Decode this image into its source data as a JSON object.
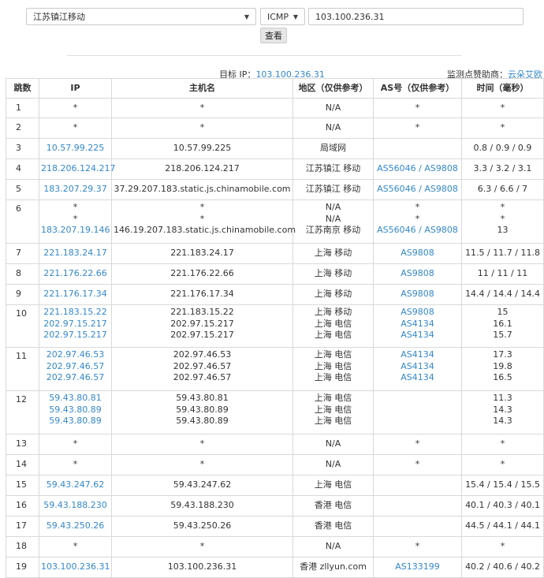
{
  "controls": {
    "location_value": "江苏镇江移动",
    "protocol_value": "ICMP",
    "target_input_value": "103.100.236.31",
    "submit_label": "查看"
  },
  "info": {
    "target_label": "目标 IP：",
    "target_ip": "103.100.236.31",
    "sponsor_label": "监测点赞助商：",
    "sponsor_name": "云朵艾欧"
  },
  "table": {
    "headers": [
      "跳数",
      "IP",
      "主机名",
      "地区（仅供参考）",
      "AS号（仅供参考）",
      "时间（毫秒）"
    ],
    "rows": [
      {
        "hop": "1",
        "ip": [
          "*"
        ],
        "host": [
          "*"
        ],
        "region": [
          "N/A"
        ],
        "as": [
          "*"
        ],
        "time": [
          "*"
        ]
      },
      {
        "hop": "2",
        "ip": [
          "*"
        ],
        "host": [
          "*"
        ],
        "region": [
          "N/A"
        ],
        "as": [
          "*"
        ],
        "time": [
          "*"
        ]
      },
      {
        "hop": "3",
        "ip": [
          "10.57.99.225"
        ],
        "host": [
          "10.57.99.225"
        ],
        "region": [
          "局域网"
        ],
        "as": [
          ""
        ],
        "time": [
          "0.8 / 0.9 / 0.9"
        ]
      },
      {
        "hop": "4",
        "ip": [
          "218.206.124.217"
        ],
        "host": [
          "218.206.124.217"
        ],
        "region": [
          "江苏镇江 移动"
        ],
        "as": [
          "AS56046 / AS9808"
        ],
        "time": [
          "3.3 / 3.2 / 3.1"
        ]
      },
      {
        "hop": "5",
        "ip": [
          "183.207.29.37"
        ],
        "host": [
          "37.29.207.183.static.js.chinamobile.com"
        ],
        "region": [
          "江苏镇江 移动"
        ],
        "as": [
          "AS56046 / AS9808"
        ],
        "time": [
          "6.3 / 6.6 / 7"
        ]
      },
      {
        "hop": "6",
        "ip": [
          "*",
          "*",
          "183.207.19.146"
        ],
        "host": [
          "*",
          "*",
          "146.19.207.183.static.js.chinamobile.com"
        ],
        "region": [
          "N/A",
          "N/A",
          "江苏南京 移动"
        ],
        "as": [
          "*",
          "*",
          "AS56046 / AS9808"
        ],
        "time": [
          "*",
          "*",
          "13"
        ]
      },
      {
        "hop": "7",
        "ip": [
          "221.183.24.17"
        ],
        "host": [
          "221.183.24.17"
        ],
        "region": [
          "上海 移动"
        ],
        "as": [
          "AS9808"
        ],
        "time": [
          "11.5 / 11.7 / 11.8"
        ]
      },
      {
        "hop": "8",
        "ip": [
          "221.176.22.66"
        ],
        "host": [
          "221.176.22.66"
        ],
        "region": [
          "上海 移动"
        ],
        "as": [
          "AS9808"
        ],
        "time": [
          "11 / 11 / 11"
        ]
      },
      {
        "hop": "9",
        "ip": [
          "221.176.17.34"
        ],
        "host": [
          "221.176.17.34"
        ],
        "region": [
          "上海 移动"
        ],
        "as": [
          "AS9808"
        ],
        "time": [
          "14.4 / 14.4 / 14.4"
        ]
      },
      {
        "hop": "10",
        "ip": [
          "221.183.15.22",
          "202.97.15.217",
          "202.97.15.217"
        ],
        "host": [
          "221.183.15.22",
          "202.97.15.217",
          "202.97.15.217"
        ],
        "region": [
          "上海 移动",
          "上海 电信",
          "上海 电信"
        ],
        "as": [
          "AS9808",
          "AS4134",
          "AS4134"
        ],
        "time": [
          "15",
          "16.1",
          "15.7"
        ]
      },
      {
        "hop": "11",
        "ip": [
          "202.97.46.53",
          "202.97.46.57",
          "202.97.46.57"
        ],
        "host": [
          "202.97.46.53",
          "202.97.46.57",
          "202.97.46.57"
        ],
        "region": [
          "上海 电信",
          "上海 电信",
          "上海 电信"
        ],
        "as": [
          "AS4134",
          "AS4134",
          "AS4134"
        ],
        "time": [
          "17.3",
          "19.8",
          "16.5"
        ]
      },
      {
        "hop": "12",
        "ip": [
          "59.43.80.81",
          "59.43.80.89",
          "59.43.80.89"
        ],
        "host": [
          "59.43.80.81",
          "59.43.80.89",
          "59.43.80.89"
        ],
        "region": [
          "上海 电信",
          "上海 电信",
          "上海 电信"
        ],
        "as": [
          "",
          "",
          ""
        ],
        "time": [
          "11.3",
          "14.3",
          "14.3"
        ]
      },
      {
        "hop": "13",
        "ip": [
          "*"
        ],
        "host": [
          "*"
        ],
        "region": [
          "N/A"
        ],
        "as": [
          "*"
        ],
        "time": [
          "*"
        ]
      },
      {
        "hop": "14",
        "ip": [
          "*"
        ],
        "host": [
          "*"
        ],
        "region": [
          "N/A"
        ],
        "as": [
          "*"
        ],
        "time": [
          "*"
        ]
      },
      {
        "hop": "15",
        "ip": [
          "59.43.247.62"
        ],
        "host": [
          "59.43.247.62"
        ],
        "region": [
          "上海 电信"
        ],
        "as": [
          ""
        ],
        "time": [
          "15.4 / 15.4 / 15.5"
        ]
      },
      {
        "hop": "16",
        "ip": [
          "59.43.188.230"
        ],
        "host": [
          "59.43.188.230"
        ],
        "region": [
          "香港 电信"
        ],
        "as": [
          ""
        ],
        "time": [
          "40.1 / 40.3 / 40.1"
        ]
      },
      {
        "hop": "17",
        "ip": [
          "59.43.250.26"
        ],
        "host": [
          "59.43.250.26"
        ],
        "region": [
          "香港 电信"
        ],
        "as": [
          ""
        ],
        "time": [
          "44.5 / 44.1 / 44.1"
        ]
      },
      {
        "hop": "18",
        "ip": [
          "*"
        ],
        "host": [
          "*"
        ],
        "region": [
          "N/A"
        ],
        "as": [
          "*"
        ],
        "time": [
          "*"
        ]
      },
      {
        "hop": "19",
        "ip": [
          "103.100.236.31"
        ],
        "host": [
          "103.100.236.31"
        ],
        "region": [
          "香港 zllyun.com"
        ],
        "as": [
          "AS133199"
        ],
        "time": [
          "40.2 / 40.6 / 40.2"
        ]
      }
    ]
  }
}
